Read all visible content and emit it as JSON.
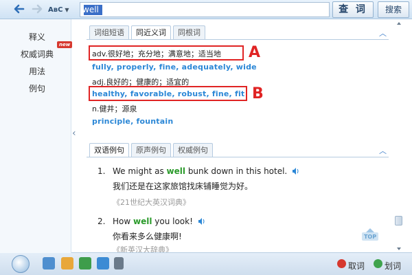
{
  "toolbar": {
    "dict_label": "AʙC",
    "query": "well",
    "query_button": "查 词",
    "search_button": "搜索"
  },
  "sidebar": {
    "items": [
      "释义",
      "权威词典",
      "用法",
      "例句"
    ],
    "new_badge": "new"
  },
  "definition_tabs": [
    "词组短语",
    "同近义词",
    "同根词"
  ],
  "synonyms": [
    {
      "definition": "adv.很好地；充分地；满意地；适当地",
      "words": "fully, properly, fine, adequately, wide"
    },
    {
      "definition": "adj.良好的；健康的；适宜的",
      "words": "healthy, favorable, robust, fine, fit"
    },
    {
      "definition": "n.健井；源泉",
      "words": "principle, fountain"
    }
  ],
  "callouts": {
    "a": "A",
    "b": "B"
  },
  "example_tabs": [
    "双语例句",
    "原声例句",
    "权威例句"
  ],
  "examples": [
    {
      "num": "1.",
      "en_pre": "We might as ",
      "en_hl": "well",
      "en_post": " bunk down in this hotel.",
      "zh": "我们还是在这家旅馆找床铺睡觉为好。",
      "source": "《21世纪大英汉词典》"
    },
    {
      "num": "2.",
      "en_pre": "How ",
      "en_hl": "well",
      "en_post": " you look!",
      "zh": "你看来多么健康啊!",
      "source": "《新英汉大辞典》"
    }
  ],
  "top_label": "TOP",
  "statusbar": {
    "fetch": "取词",
    "select": "划词"
  },
  "colors": {
    "accent": "#2b87d6",
    "highlight": "#e02424",
    "keyword": "#2a9a2a"
  }
}
